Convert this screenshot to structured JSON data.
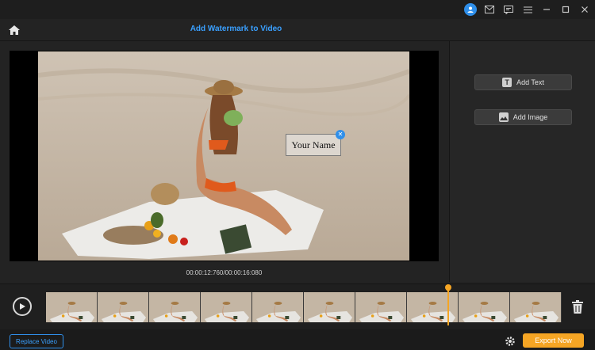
{
  "header": {
    "title": "Add Watermark to Video"
  },
  "titlebar": {
    "icons": [
      "user-icon",
      "mail-icon",
      "feedback-icon",
      "menu-icon",
      "minimize-icon",
      "maximize-icon",
      "close-icon"
    ]
  },
  "preview": {
    "watermark_text": "Your Name",
    "timecode": "00:00:12:760/00:00:16:080"
  },
  "side_panel": {
    "add_text_label": "Add Text",
    "add_image_label": "Add Image"
  },
  "timeline": {
    "frame_count": 10,
    "playhead_progress": 0.78
  },
  "bottom": {
    "replace_label": "Replace Video",
    "export_label": "Export Now"
  },
  "colors": {
    "accent_blue": "#3aa0ff",
    "export_orange": "#f5a524",
    "background": "#232323"
  }
}
